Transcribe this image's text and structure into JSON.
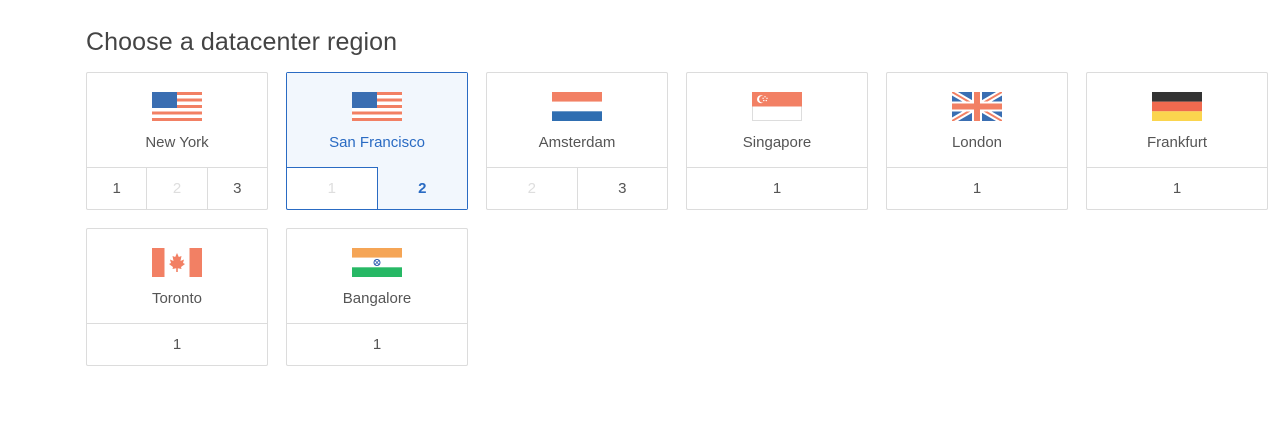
{
  "heading": "Choose a datacenter region",
  "regions": [
    {
      "city": "New York",
      "flag": "usa-flag-icon",
      "datacenters": [
        {
          "label": "1",
          "state": "normal"
        },
        {
          "label": "2",
          "state": "disabled"
        },
        {
          "label": "3",
          "state": "normal"
        }
      ]
    },
    {
      "city": "San Francisco",
      "flag": "usa-flag-icon",
      "selected": true,
      "datacenters": [
        {
          "label": "1",
          "state": "disabled"
        },
        {
          "label": "2",
          "state": "active"
        }
      ]
    },
    {
      "city": "Amsterdam",
      "flag": "netherlands-flag-icon",
      "datacenters": [
        {
          "label": "2",
          "state": "disabled"
        },
        {
          "label": "3",
          "state": "normal"
        }
      ]
    },
    {
      "city": "Singapore",
      "flag": "singapore-flag-icon",
      "datacenters": [
        {
          "label": "1",
          "state": "normal"
        }
      ]
    },
    {
      "city": "London",
      "flag": "uk-flag-icon",
      "datacenters": [
        {
          "label": "1",
          "state": "normal"
        }
      ]
    },
    {
      "city": "Frankfurt",
      "flag": "germany-flag-icon",
      "datacenters": [
        {
          "label": "1",
          "state": "normal"
        }
      ]
    },
    {
      "city": "Toronto",
      "flag": "canada-flag-icon",
      "datacenters": [
        {
          "label": "1",
          "state": "normal"
        }
      ]
    },
    {
      "city": "Bangalore",
      "flag": "india-flag-icon",
      "datacenters": [
        {
          "label": "1",
          "state": "normal"
        }
      ]
    }
  ],
  "colors": {
    "accent": "#2a6bc3",
    "selected_bg": "#f2f7fd",
    "border": "#dcdcdc",
    "disabled_text": "#dedede"
  }
}
